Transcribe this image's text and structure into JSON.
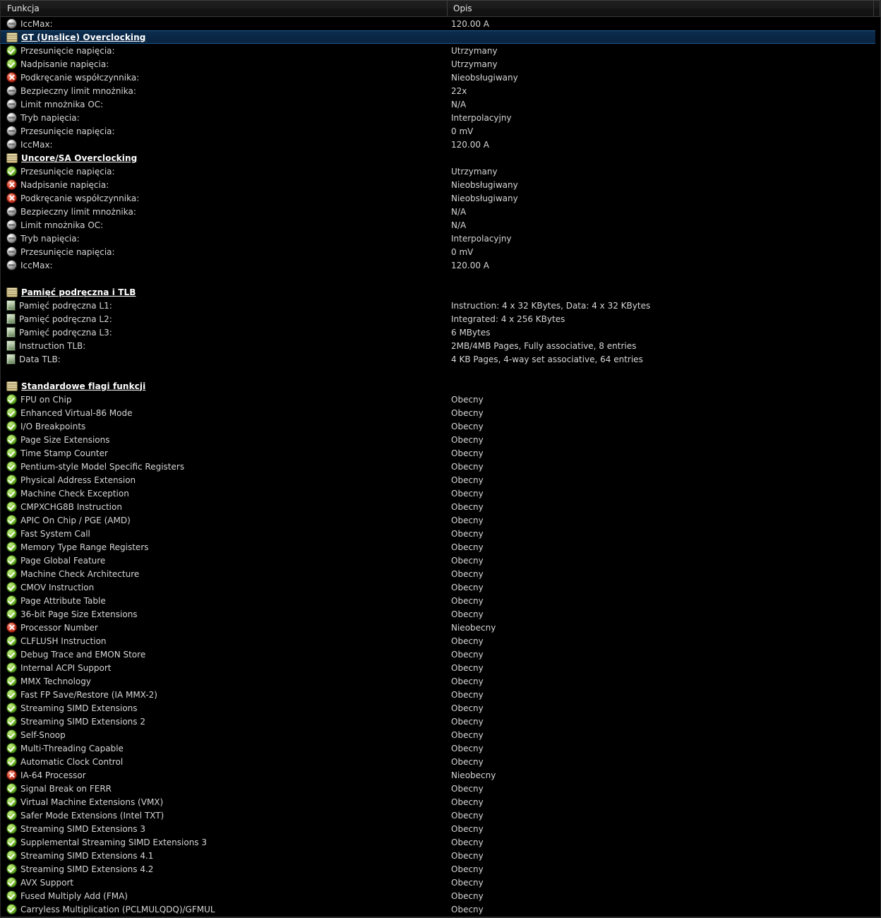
{
  "window": {
    "title": "Funkcje procesora",
    "theme_background": "#000000",
    "selection_color": "#0a2746",
    "selection_border": "#1d5a93",
    "text_color": "#d6d6d6"
  },
  "header": {
    "col_feature": "Funkcja",
    "col_description": "Opis"
  },
  "icons": {
    "present": "green-check-icon",
    "absent": "red-x-icon",
    "info": "gray-sphere-icon",
    "section": "section-book-icon",
    "memory": "memory-chip-icon"
  },
  "rows": [
    {
      "icon": "info",
      "label": "IccMax:",
      "value": "120.00 A",
      "type": "item"
    },
    {
      "icon": "section",
      "label": "GT (Unslice) Overclocking",
      "value": "",
      "type": "section",
      "selected": true
    },
    {
      "icon": "present",
      "label": "Przesunięcie napięcia:",
      "value": "Utrzymany",
      "type": "item"
    },
    {
      "icon": "present",
      "label": "Nadpisanie napięcia:",
      "value": "Utrzymany",
      "type": "item"
    },
    {
      "icon": "absent",
      "label": "Podkręcanie współczynnika:",
      "value": "Nieobsługiwany",
      "type": "item"
    },
    {
      "icon": "info",
      "label": "Bezpieczny limit mnożnika:",
      "value": "22x",
      "type": "item"
    },
    {
      "icon": "info",
      "label": "Limit mnożnika OC:",
      "value": "N/A",
      "type": "item"
    },
    {
      "icon": "info",
      "label": "Tryb napięcia:",
      "value": "Interpolacyjny",
      "type": "item"
    },
    {
      "icon": "info",
      "label": "Przesunięcie napięcia:",
      "value": "0 mV",
      "type": "item"
    },
    {
      "icon": "info",
      "label": "IccMax:",
      "value": "120.00 A",
      "type": "item"
    },
    {
      "icon": "section",
      "label": "Uncore/SA Overclocking",
      "value": "",
      "type": "section"
    },
    {
      "icon": "present",
      "label": "Przesunięcie napięcia:",
      "value": "Utrzymany",
      "type": "item"
    },
    {
      "icon": "absent",
      "label": "Nadpisanie napięcia:",
      "value": "Nieobsługiwany",
      "type": "item"
    },
    {
      "icon": "absent",
      "label": "Podkręcanie współczynnika:",
      "value": "Nieobsługiwany",
      "type": "item"
    },
    {
      "icon": "info",
      "label": "Bezpieczny limit mnożnika:",
      "value": "N/A",
      "type": "item"
    },
    {
      "icon": "info",
      "label": "Limit mnożnika OC:",
      "value": "N/A",
      "type": "item"
    },
    {
      "icon": "info",
      "label": "Tryb napięcia:",
      "value": "Interpolacyjny",
      "type": "item"
    },
    {
      "icon": "info",
      "label": "Przesunięcie napięcia:",
      "value": "0 mV",
      "type": "item"
    },
    {
      "icon": "info",
      "label": "IccMax:",
      "value": "120.00 A",
      "type": "item"
    },
    {
      "icon": "blank",
      "label": "",
      "value": "",
      "type": "spacer"
    },
    {
      "icon": "section",
      "label": "Pamięć podręczna i TLB",
      "value": "",
      "type": "section"
    },
    {
      "icon": "memory",
      "label": "Pamięć podręczna L1:",
      "value": "Instruction: 4 x 32 KBytes, Data: 4 x 32 KBytes",
      "type": "item"
    },
    {
      "icon": "memory",
      "label": "Pamięć podręczna L2:",
      "value": "Integrated: 4 x 256 KBytes",
      "type": "item"
    },
    {
      "icon": "memory",
      "label": "Pamięć podręczna L3:",
      "value": "6 MBytes",
      "type": "item"
    },
    {
      "icon": "memory",
      "label": "Instruction TLB:",
      "value": "2MB/4MB Pages, Fully associative, 8 entries",
      "type": "item"
    },
    {
      "icon": "memory",
      "label": "Data TLB:",
      "value": "4 KB Pages, 4-way set associative, 64 entries",
      "type": "item"
    },
    {
      "icon": "blank",
      "label": "",
      "value": "",
      "type": "spacer"
    },
    {
      "icon": "section",
      "label": "Standardowe flagi funkcji",
      "value": "",
      "type": "section"
    },
    {
      "icon": "present",
      "label": "FPU on Chip",
      "value": "Obecny",
      "type": "item"
    },
    {
      "icon": "present",
      "label": "Enhanced Virtual-86 Mode",
      "value": "Obecny",
      "type": "item"
    },
    {
      "icon": "present",
      "label": "I/O Breakpoints",
      "value": "Obecny",
      "type": "item"
    },
    {
      "icon": "present",
      "label": "Page Size Extensions",
      "value": "Obecny",
      "type": "item"
    },
    {
      "icon": "present",
      "label": "Time Stamp Counter",
      "value": "Obecny",
      "type": "item"
    },
    {
      "icon": "present",
      "label": "Pentium-style Model Specific Registers",
      "value": "Obecny",
      "type": "item"
    },
    {
      "icon": "present",
      "label": "Physical Address Extension",
      "value": "Obecny",
      "type": "item"
    },
    {
      "icon": "present",
      "label": "Machine Check Exception",
      "value": "Obecny",
      "type": "item"
    },
    {
      "icon": "present",
      "label": "CMPXCHG8B Instruction",
      "value": "Obecny",
      "type": "item"
    },
    {
      "icon": "present",
      "label": "APIC On Chip / PGE (AMD)",
      "value": "Obecny",
      "type": "item"
    },
    {
      "icon": "present",
      "label": "Fast System Call",
      "value": "Obecny",
      "type": "item"
    },
    {
      "icon": "present",
      "label": "Memory Type Range Registers",
      "value": "Obecny",
      "type": "item"
    },
    {
      "icon": "present",
      "label": "Page Global Feature",
      "value": "Obecny",
      "type": "item"
    },
    {
      "icon": "present",
      "label": "Machine Check Architecture",
      "value": "Obecny",
      "type": "item"
    },
    {
      "icon": "present",
      "label": "CMOV Instruction",
      "value": "Obecny",
      "type": "item"
    },
    {
      "icon": "present",
      "label": "Page Attribute Table",
      "value": "Obecny",
      "type": "item"
    },
    {
      "icon": "present",
      "label": "36-bit Page Size Extensions",
      "value": "Obecny",
      "type": "item"
    },
    {
      "icon": "absent",
      "label": "Processor Number",
      "value": "Nieobecny",
      "type": "item"
    },
    {
      "icon": "present",
      "label": "CLFLUSH Instruction",
      "value": "Obecny",
      "type": "item"
    },
    {
      "icon": "present",
      "label": "Debug Trace and EMON Store",
      "value": "Obecny",
      "type": "item"
    },
    {
      "icon": "present",
      "label": "Internal ACPI Support",
      "value": "Obecny",
      "type": "item"
    },
    {
      "icon": "present",
      "label": "MMX Technology",
      "value": "Obecny",
      "type": "item"
    },
    {
      "icon": "present",
      "label": "Fast FP Save/Restore (IA MMX-2)",
      "value": "Obecny",
      "type": "item"
    },
    {
      "icon": "present",
      "label": "Streaming SIMD Extensions",
      "value": "Obecny",
      "type": "item"
    },
    {
      "icon": "present",
      "label": "Streaming SIMD Extensions 2",
      "value": "Obecny",
      "type": "item"
    },
    {
      "icon": "present",
      "label": "Self-Snoop",
      "value": "Obecny",
      "type": "item"
    },
    {
      "icon": "present",
      "label": "Multi-Threading Capable",
      "value": "Obecny",
      "type": "item"
    },
    {
      "icon": "present",
      "label": "Automatic Clock Control",
      "value": "Obecny",
      "type": "item"
    },
    {
      "icon": "absent",
      "label": "IA-64 Processor",
      "value": "Nieobecny",
      "type": "item"
    },
    {
      "icon": "present",
      "label": "Signal Break on FERR",
      "value": "Obecny",
      "type": "item"
    },
    {
      "icon": "present",
      "label": "Virtual Machine Extensions (VMX)",
      "value": "Obecny",
      "type": "item"
    },
    {
      "icon": "present",
      "label": "Safer Mode Extensions (Intel TXT)",
      "value": "Obecny",
      "type": "item"
    },
    {
      "icon": "present",
      "label": "Streaming SIMD Extensions 3",
      "value": "Obecny",
      "type": "item"
    },
    {
      "icon": "present",
      "label": "Supplemental Streaming SIMD Extensions 3",
      "value": "Obecny",
      "type": "item"
    },
    {
      "icon": "present",
      "label": "Streaming SIMD Extensions 4.1",
      "value": "Obecny",
      "type": "item"
    },
    {
      "icon": "present",
      "label": "Streaming SIMD Extensions 4.2",
      "value": "Obecny",
      "type": "item"
    },
    {
      "icon": "present",
      "label": "AVX Support",
      "value": "Obecny",
      "type": "item"
    },
    {
      "icon": "present",
      "label": "Fused Multiply Add (FMA)",
      "value": "Obecny",
      "type": "item"
    },
    {
      "icon": "present",
      "label": "Carryless Multiplication (PCLMULQDQ)/GFMUL",
      "value": "Obecny",
      "type": "item"
    }
  ]
}
